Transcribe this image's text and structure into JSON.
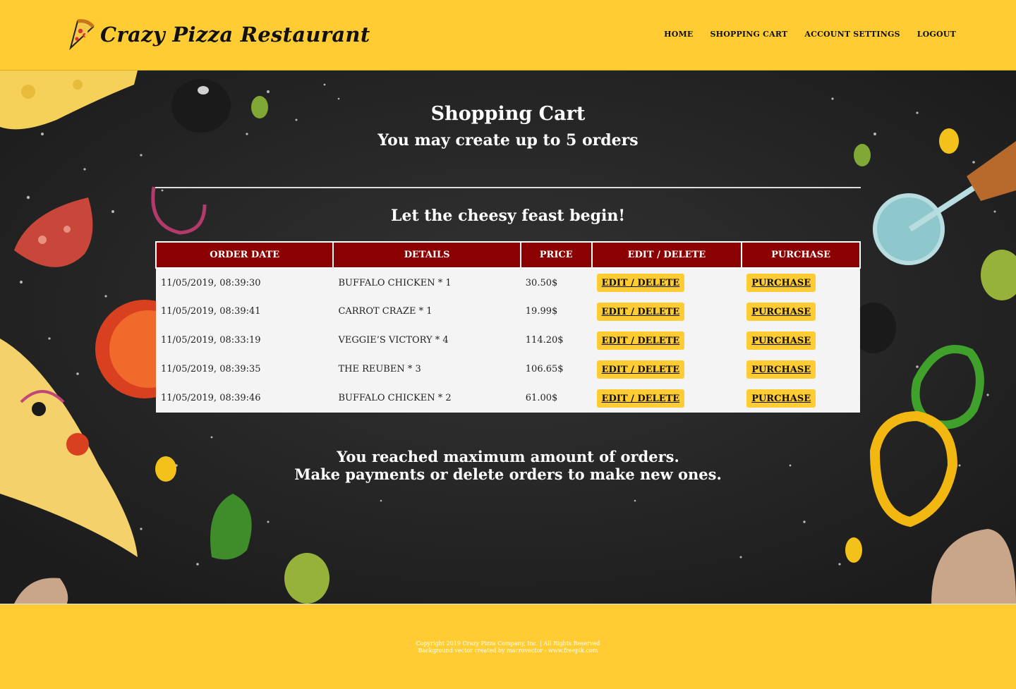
{
  "header": {
    "brand": "Crazy Pizza Restaurant",
    "nav": [
      "HOME",
      "SHOPPING CART",
      "ACCOUNT SETTINGS",
      "LOGOUT"
    ]
  },
  "main": {
    "title": "Shopping Cart",
    "subtitle": "You may create up to 5 orders",
    "tagline": "Let the cheesy feast begin!",
    "table": {
      "headers": [
        "ORDER DATE",
        "DETAILS",
        "PRICE",
        "EDIT / DELETE",
        "PURCHASE"
      ],
      "rows": [
        {
          "date": "11/05/2019, 08:39:30",
          "details": "BUFFALO CHICKEN * 1",
          "price": "30.50$",
          "edit": "EDIT / DELETE",
          "purchase": "PURCHASE"
        },
        {
          "date": "11/05/2019, 08:39:41",
          "details": "CARROT CRAZE * 1",
          "price": "19.99$",
          "edit": "EDIT / DELETE",
          "purchase": "PURCHASE"
        },
        {
          "date": "11/05/2019, 08:33:19",
          "details": "VEGGIE’S VICTORY * 4",
          "price": "114.20$",
          "edit": "EDIT / DELETE",
          "purchase": "PURCHASE"
        },
        {
          "date": "11/05/2019, 08:39:35",
          "details": "THE REUBEN * 3",
          "price": "106.65$",
          "edit": "EDIT / DELETE",
          "purchase": "PURCHASE"
        },
        {
          "date": "11/05/2019, 08:39:46",
          "details": "BUFFALO CHICKEN * 2",
          "price": "61.00$",
          "edit": "EDIT / DELETE",
          "purchase": "PURCHASE"
        }
      ]
    },
    "message_line1": "You reached maximum amount of orders.",
    "message_line2": "Make payments or delete orders to make new ones."
  },
  "footer": {
    "copyright": "Copyright 2019 Crazy Pizza Company, Inc. | All Rights Reserved",
    "credit": "Background vector created by macrovector - www.freepik.com"
  },
  "colors": {
    "accent": "#ffcd33",
    "table_header": "#8b0000",
    "background": "#2a2a2a"
  },
  "icons": [
    "pizza-slice-logo-icon"
  ]
}
